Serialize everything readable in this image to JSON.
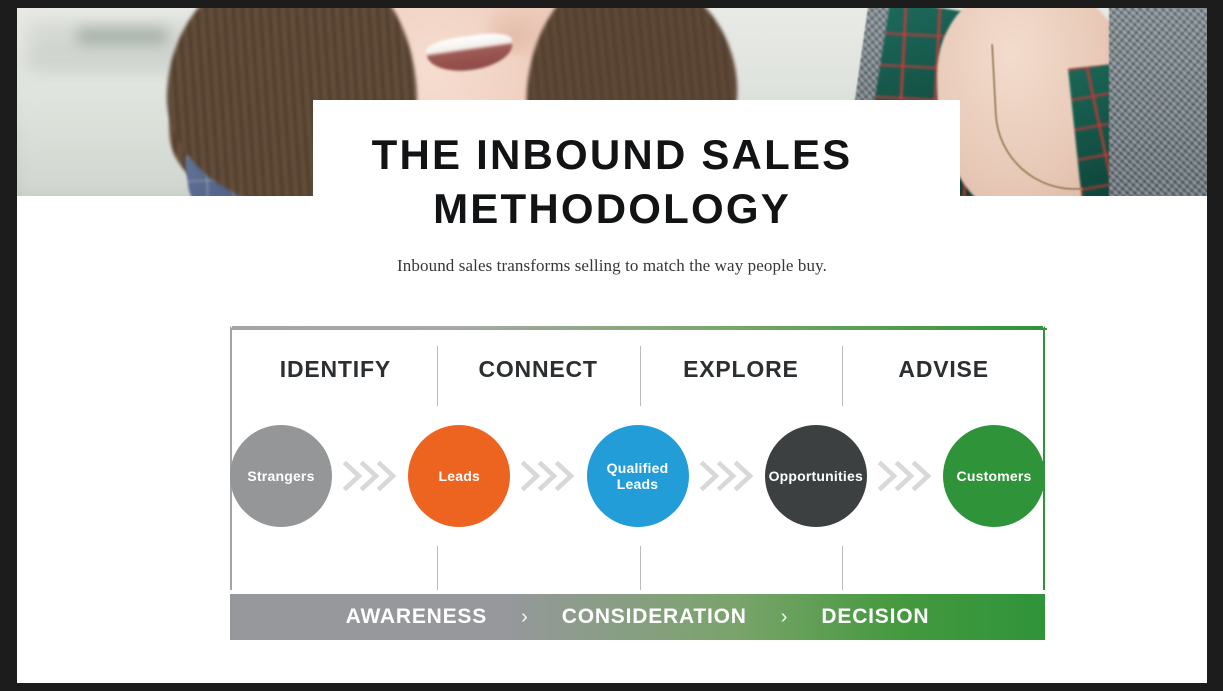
{
  "header": {
    "title": "THE INBOUND SALES METHODOLOGY",
    "subtitle": "Inbound sales transforms selling to match the way people buy.",
    "photo_alt": "two-people-talking-photo"
  },
  "diagram": {
    "stages": [
      {
        "label": "IDENTIFY"
      },
      {
        "label": "CONNECT"
      },
      {
        "label": "EXPLORE"
      },
      {
        "label": "ADVISE"
      }
    ],
    "nodes": [
      {
        "label": "Strangers",
        "color": "#949698"
      },
      {
        "label": "Leads",
        "color": "#ec6420"
      },
      {
        "label": "Qualified\nLeads",
        "color": "#229dd8"
      },
      {
        "label": "Opportunities",
        "color": "#3d4040"
      },
      {
        "label": "Customers",
        "color": "#2f9439"
      }
    ],
    "arrows": [
      {
        "name": "chevron-arrow-1"
      },
      {
        "name": "chevron-arrow-2"
      },
      {
        "name": "chevron-arrow-3"
      },
      {
        "name": "chevron-arrow-4"
      }
    ],
    "funnel": {
      "items": [
        {
          "label": "AWARENESS"
        },
        {
          "label": "CONSIDERATION"
        },
        {
          "label": "DECISION"
        }
      ],
      "separator": "›",
      "gradient_start": "#96989b",
      "gradient_end": "#2f9439"
    },
    "border_left_color": "#a2a4a6",
    "border_right_color": "#2f9439",
    "arrow_color": "#d8d8d8"
  }
}
